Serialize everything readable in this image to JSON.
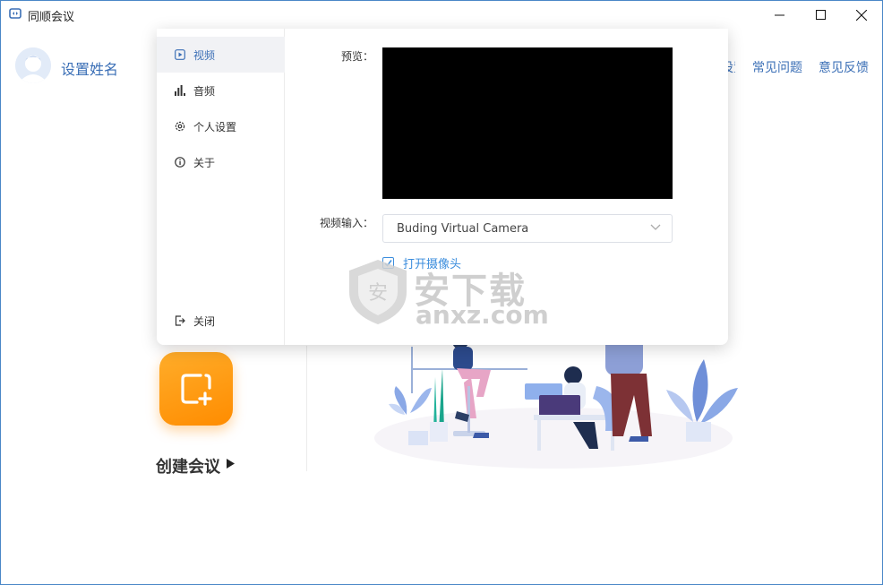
{
  "window": {
    "title": "同顺会议",
    "minimize_icon": "minimize-icon",
    "maximize_icon": "maximize-icon",
    "close_icon": "close-icon"
  },
  "header": {
    "user_name": "设置姓名",
    "links": {
      "settings": "设置",
      "faq": "常见问题",
      "feedback": "意见反馈"
    }
  },
  "main": {
    "create_meeting_label": "创建会议"
  },
  "settings_dialog": {
    "nav": [
      {
        "label": "视频",
        "icon": "video-icon",
        "active": true
      },
      {
        "label": "音频",
        "icon": "audio-bars-icon"
      },
      {
        "label": "个人设置",
        "icon": "gear-icon"
      },
      {
        "label": "关于",
        "icon": "info-icon"
      }
    ],
    "close_label": "关闭",
    "preview_label": "预览：",
    "video_input_label": "视频输入：",
    "video_input_value": "Buding Virtual Camera",
    "open_camera_label": "打开摄像头",
    "open_camera_checked": true
  },
  "watermark": {
    "text": "安下载",
    "url": "anxz.com"
  },
  "colors": {
    "accent": "#3b6fb6",
    "link": "#3b8ddd",
    "orange": "#ff9a10",
    "border": "#4a87c7"
  }
}
